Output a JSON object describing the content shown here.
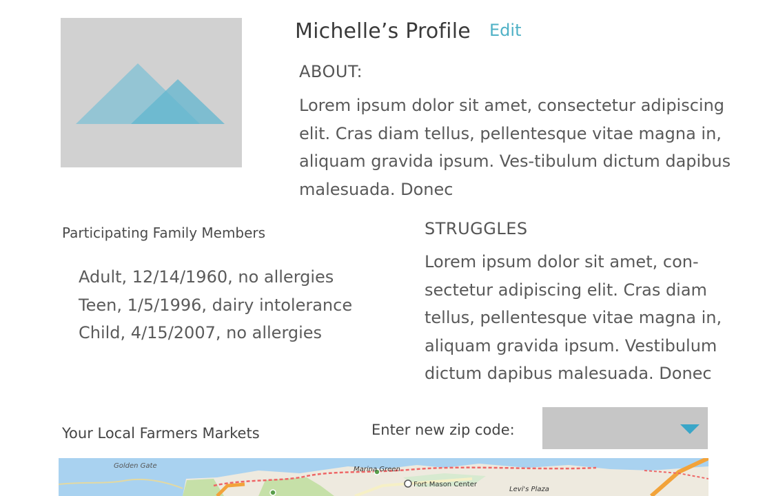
{
  "profile": {
    "title": "Michelle’s Profile",
    "edit_label": "Edit",
    "about_label": "ABOUT:",
    "about_text": "Lorem ipsum dolor sit amet, consectetur adipiscing elit. Cras diam tellus, pellentesque vitae magna in, aliquam gravida ipsum. Ves-tibulum dictum dapibus malesuada. Donec"
  },
  "family": {
    "heading": "Participating Family Members",
    "members": [
      "Adult, 12/14/1960, no allergies",
      "Teen, 1/5/1996, dairy intolerance",
      "Child, 4/15/2007, no allergies"
    ]
  },
  "struggles": {
    "label": "STRUGGLES",
    "text": "Lorem ipsum dolor sit amet, con-sectetur adipiscing elit. Cras diam tellus, pellentesque vitae magna in, aliquam gravida ipsum. Vestibulum dictum dapibus malesuada. Donec"
  },
  "markets": {
    "heading": "Your Local Farmers Markets",
    "zip_label": "Enter new zip code:",
    "zip_value": ""
  },
  "map": {
    "labels": [
      "Golden Gate",
      "Marina Green",
      "Fort Mason Center",
      "Levi's Plaza"
    ]
  },
  "colors": {
    "accent": "#4fb1c6",
    "placeholder_bg": "#d1d1d1",
    "select_bg": "#c6c6c6",
    "caret": "#3aa6c8"
  },
  "icons": {
    "avatar": "mountain-image-icon",
    "dropdown": "caret-down-icon",
    "map_pin": "map-pin-icon"
  }
}
